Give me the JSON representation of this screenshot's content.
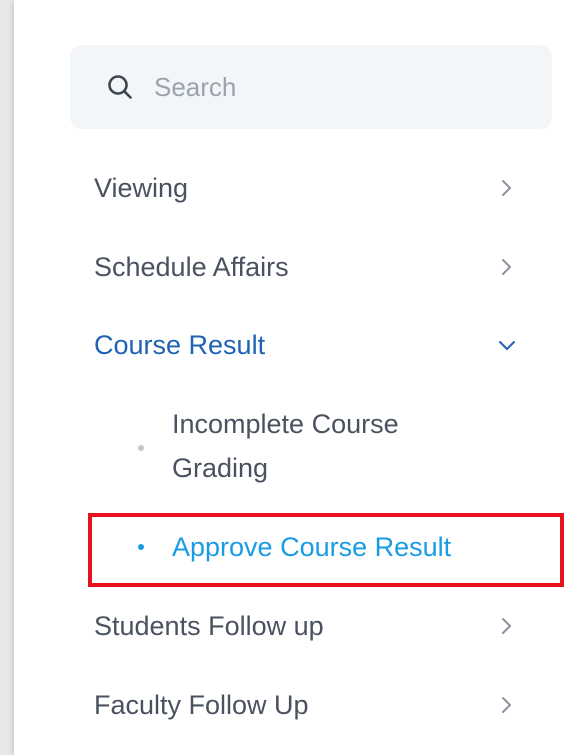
{
  "search": {
    "placeholder": "Search"
  },
  "nav": {
    "items": [
      {
        "label": "Viewing",
        "chevron": "chevron-right-icon"
      },
      {
        "label": "Schedule Affairs",
        "chevron": "chevron-right-icon"
      },
      {
        "label": "Course Result",
        "chevron": "chevron-down-icon",
        "active": true
      },
      {
        "label": "Students Follow up",
        "chevron": "chevron-right-icon"
      },
      {
        "label": "Faculty Follow Up",
        "chevron": "chevron-right-icon"
      }
    ],
    "course_result_children": [
      {
        "line1": "Incomplete Course",
        "line2": "Grading"
      },
      {
        "label": "Approve Course Result",
        "selected": true
      }
    ]
  },
  "colors": {
    "text": "#4a5260",
    "active": "#1f63b3",
    "selected": "#1a9be6",
    "highlight": "#e8121c",
    "search_bg": "#f3f6f9"
  }
}
